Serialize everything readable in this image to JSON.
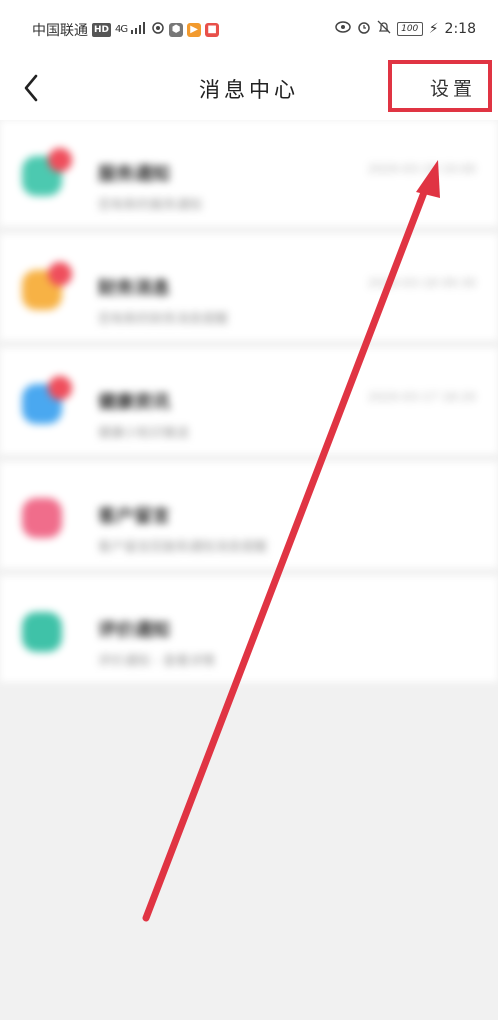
{
  "status_bar": {
    "carrier": "中国联通",
    "hd_badge": "HD",
    "network": "4G",
    "battery": "100",
    "time": "2:18"
  },
  "header": {
    "title": "消息中心",
    "settings_label": "设置"
  },
  "messages": [
    {
      "title": "服务通知",
      "subtitle": "您有新的服务通知",
      "time": "2020-03-18 10:00",
      "icon": "service-icon",
      "color": "#4cc9b0"
    },
    {
      "title": "财务消息",
      "subtitle": "您有新的财务消息提醒",
      "time": "2020-03-18 09:30",
      "icon": "finance-icon",
      "color": "#f7b245"
    },
    {
      "title": "健康资讯",
      "subtitle": "健康小知识推送",
      "time": "2020-03-17 18:20",
      "icon": "health-icon",
      "color": "#4aa8f0"
    },
    {
      "title": "客户留言",
      "subtitle": "客户留言回复和通知消息提醒",
      "time": "",
      "icon": "customer-icon",
      "color": "#f06d8b"
    },
    {
      "title": "评价通知",
      "subtitle": "评价通知 - 查看详情",
      "time": "",
      "icon": "review-icon",
      "color": "#3fc2a8"
    }
  ],
  "colors": {
    "accent": "#e03443",
    "unread_dot": "#ef4e5c"
  }
}
